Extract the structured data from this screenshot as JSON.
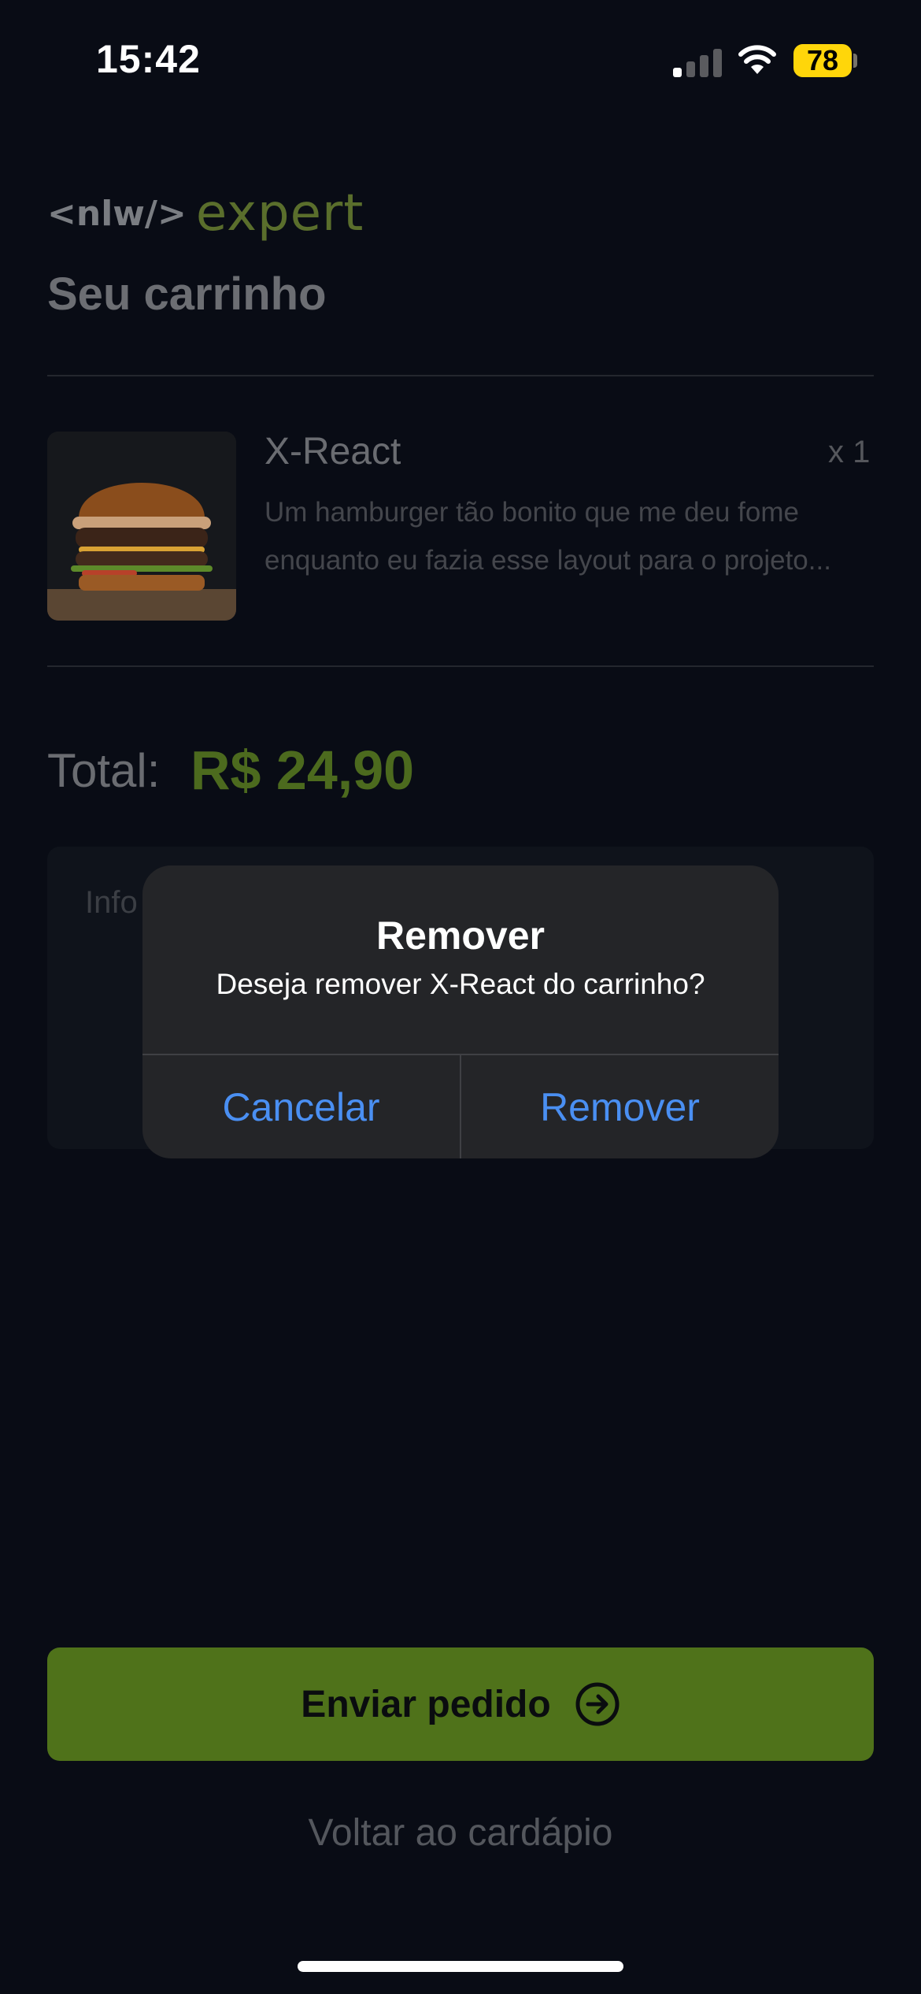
{
  "status_bar": {
    "time": "15:42",
    "battery": "78",
    "icons": [
      "signal-icon",
      "wifi-icon",
      "battery-icon"
    ]
  },
  "colors": {
    "background": "#090c15",
    "accent": "#4f721a",
    "price": "#4c6a1e",
    "alert_button": "#4a8ff2",
    "battery": "#ffd60a"
  },
  "header": {
    "logo_code": "<nlw/>",
    "logo_expert": "expert",
    "title": "Seu carrinho"
  },
  "cart": {
    "items": [
      {
        "name": "X-React",
        "quantity": "x 1",
        "description": "Um hamburger tão bonito que me deu fome enquanto eu fazia esse layout para o projeto..."
      }
    ]
  },
  "total": {
    "label": "Total:",
    "value": "R$ 24,90"
  },
  "address": {
    "placeholder": "Info"
  },
  "actions": {
    "send_label": "Enviar pedido",
    "back_label": "Voltar ao cardápio"
  },
  "alert": {
    "title": "Remover",
    "message": "Deseja remover X-React do carrinho?",
    "cancel_label": "Cancelar",
    "confirm_label": "Remover"
  }
}
